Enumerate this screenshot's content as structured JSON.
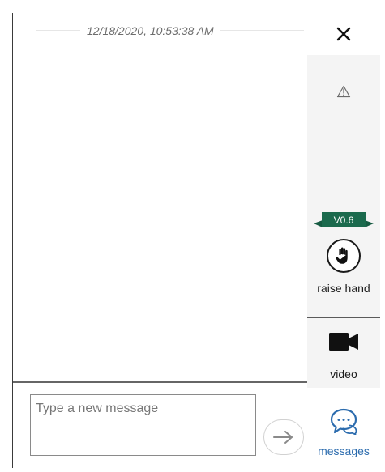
{
  "chat": {
    "timestamp": "12/18/2020, 10:53:38 AM"
  },
  "composer": {
    "placeholder": "Type a new message"
  },
  "sidebar": {
    "close_icon": "close-icon",
    "warning_icon": "warning-icon",
    "version": "V0.6",
    "raise_hand": {
      "icon": "hand-icon",
      "label": "raise hand"
    },
    "video": {
      "icon": "video-icon",
      "label": "video"
    },
    "messages": {
      "icon": "chat-bubbles-icon",
      "label": "messages"
    }
  },
  "colors": {
    "accent_blue": "#2c6cae",
    "banner_green": "#1b6a4d"
  }
}
